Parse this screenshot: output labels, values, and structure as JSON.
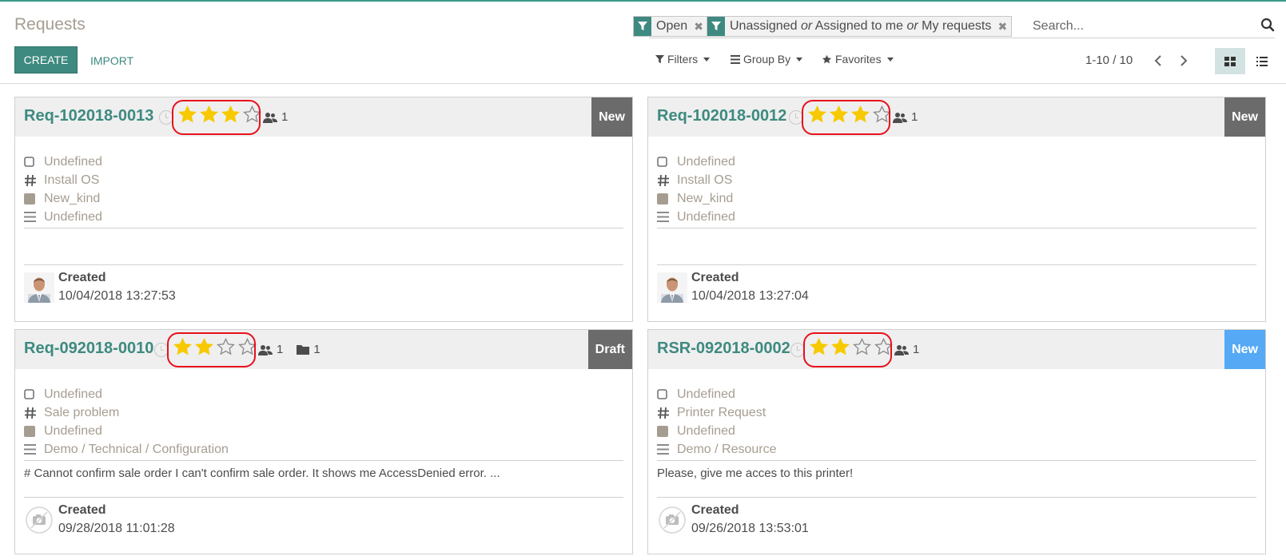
{
  "breadcrumb": "Requests",
  "buttons": {
    "create": "CREATE",
    "import": "IMPORT"
  },
  "search": {
    "facet_open": "Open",
    "facet_assign": {
      "a": "Unassigned",
      "or1": "or",
      "b": "Assigned to me",
      "or2": "or",
      "c": "My requests"
    },
    "placeholder": "Search..."
  },
  "menus": {
    "filters": "Filters",
    "group_by": "Group By",
    "favorites": "Favorites"
  },
  "pager": {
    "text": "1-10 / 10"
  },
  "colors": {
    "accent": "#3e8a80",
    "star_on": "#f7c900",
    "highlight": "#e8101c",
    "stage_gray": "#6b6b6b",
    "stage_blue": "#55a9f5"
  },
  "cards": [
    {
      "title": "Req-102018-0013",
      "stars": 3,
      "followers": "1",
      "docs": "",
      "stage": "New",
      "stage_color": "#6b6b6b",
      "fields": [
        "Undefined",
        "Install OS",
        "New_kind",
        "Undefined"
      ],
      "description": "",
      "created_label": "Created",
      "created_date": "10/04/2018 13:27:53",
      "avatar": "person-photo"
    },
    {
      "title": "Req-102018-0012",
      "stars": 3,
      "followers": "1",
      "docs": "",
      "stage": "New",
      "stage_color": "#6b6b6b",
      "fields": [
        "Undefined",
        "Install OS",
        "New_kind",
        "Undefined"
      ],
      "description": "",
      "created_label": "Created",
      "created_date": "10/04/2018 13:27:04",
      "avatar": "person-photo"
    },
    {
      "title": "Req-092018-0010",
      "stars": 2,
      "followers": "1",
      "docs": "1",
      "stage": "Draft",
      "stage_color": "#6b6b6b",
      "fields": [
        "Undefined",
        "Sale problem",
        "Undefined",
        "Demo / Technical / Configuration"
      ],
      "description": "# Cannot confirm sale order I can't confirm sale order. It shows me AccessDenied error. ...",
      "created_label": "Created",
      "created_date": "09/28/2018 11:01:28",
      "avatar": "camera-placeholder"
    },
    {
      "title": "RSR-092018-0002",
      "stars": 2,
      "followers": "1",
      "docs": "",
      "stage": "New",
      "stage_color": "#55a9f5",
      "fields": [
        "Undefined",
        "Printer Request",
        "Undefined",
        "Demo / Resource"
      ],
      "description": "Please, give me acces to this printer!",
      "created_label": "Created",
      "created_date": "09/26/2018 13:53:01",
      "avatar": "camera-placeholder"
    }
  ]
}
